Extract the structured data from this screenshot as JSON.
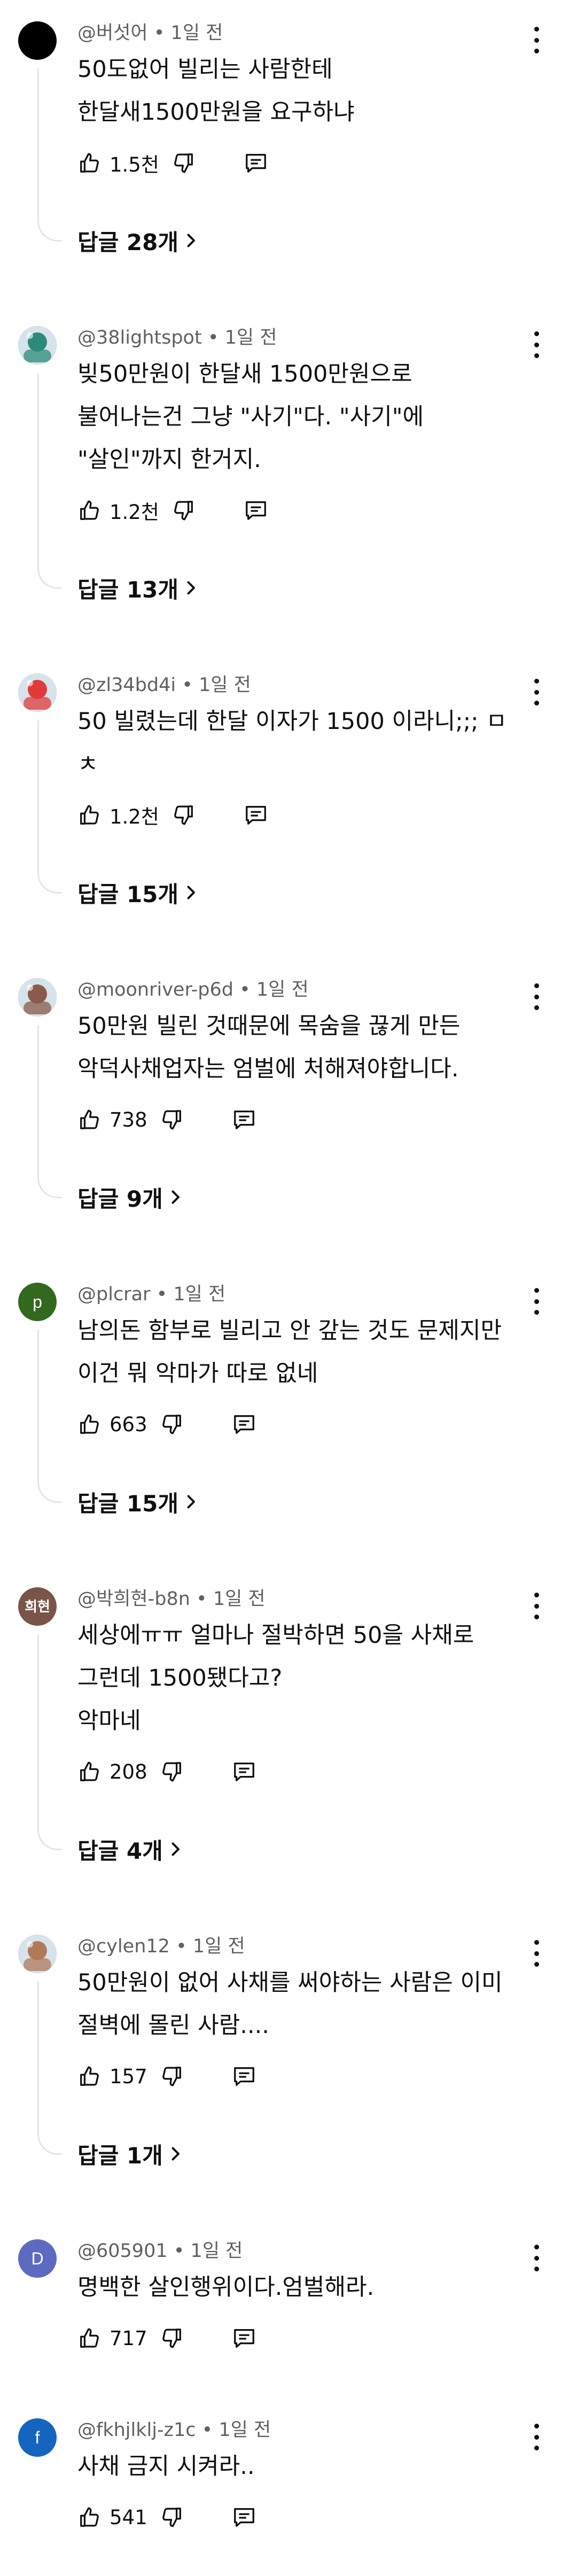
{
  "comments": [
    {
      "author": "@버섯어",
      "time": "1일 전",
      "lines": [
        "50도없어 빌리는 사람한테",
        "한달새1500만원을 요구하냐"
      ],
      "likes": "1.5천",
      "replies": "답글 28개",
      "avatar": {
        "type": "dark",
        "color": "#000000"
      }
    },
    {
      "author": "@38lightspot",
      "time": "1일 전",
      "lines": [
        "빚50만원이 한달새 1500만원으로",
        "불어나는건 그냥 \"사기\"다. \"사기\"에",
        "\"살인\"까지 한거지."
      ],
      "likes": "1.2천",
      "replies": "답글 13개",
      "avatar": {
        "type": "image",
        "color": "#2c8a7a"
      }
    },
    {
      "author": "@zl34bd4i",
      "time": "1일 전",
      "lines": [
        "50 빌렸는데 한달 이자가 1500 이라니;;;  ㅁ",
        "ㅊ"
      ],
      "likes": "1.2천",
      "replies": "답글 15개",
      "avatar": {
        "type": "image",
        "color": "#e23a3a"
      }
    },
    {
      "author": "@moonriver-p6d",
      "time": "1일 전",
      "lines": [
        "50만원 빌린 것때문에 목숨을 끊게 만든",
        "악덕사채업자는 엄벌에 처해져야합니다."
      ],
      "likes": "738",
      "replies": "답글 9개",
      "avatar": {
        "type": "image",
        "color": "#8a5a4a"
      }
    },
    {
      "author": "@plcrar",
      "time": "1일 전",
      "lines": [
        "남의돈 함부로 빌리고 안 갚는 것도 문제지만",
        "이건 뭐 악마가 따로 없네"
      ],
      "likes": "663",
      "replies": "답글 15개",
      "avatar": {
        "type": "letter",
        "letter": "p",
        "color": "#33691e"
      }
    },
    {
      "author": "@박희현-b8n",
      "time": "1일 전",
      "lines": [
        "세상에ㅠㅠ 얼마나 절박하면 50을 사채로",
        "그런데 1500됐다고?",
        "악마네"
      ],
      "likes": "208",
      "replies": "답글 4개",
      "avatar": {
        "type": "letter",
        "letter": "희현",
        "color": "#795548"
      }
    },
    {
      "author": "@cylen12",
      "time": "1일 전",
      "lines": [
        "50만원이 없어 사채를 써야하는 사람은 이미",
        "절벽에 몰린 사람...."
      ],
      "likes": "157",
      "replies": "답글 1개",
      "avatar": {
        "type": "image",
        "color": "#b07a5a"
      }
    },
    {
      "author": "@605901",
      "time": "1일 전",
      "lines": [
        "명백한 살인행위이다.엄벌해라."
      ],
      "likes": "717",
      "replies": "",
      "avatar": {
        "type": "letter",
        "letter": "D",
        "color": "#5c6bc0"
      }
    },
    {
      "author": "@fkhjlklj-z1c",
      "time": "1일 전",
      "lines": [
        "사채 금지 시켜라.."
      ],
      "likes": "541",
      "replies": "",
      "avatar": {
        "type": "letter",
        "letter": "f",
        "color": "#1565c0"
      }
    }
  ],
  "separator": "•",
  "icons": {
    "like": "thumbs-up-icon",
    "dislike": "thumbs-down-icon",
    "reply": "comment-reply-icon",
    "more": "more-vert-icon",
    "chevron": "chevron-right-icon"
  }
}
